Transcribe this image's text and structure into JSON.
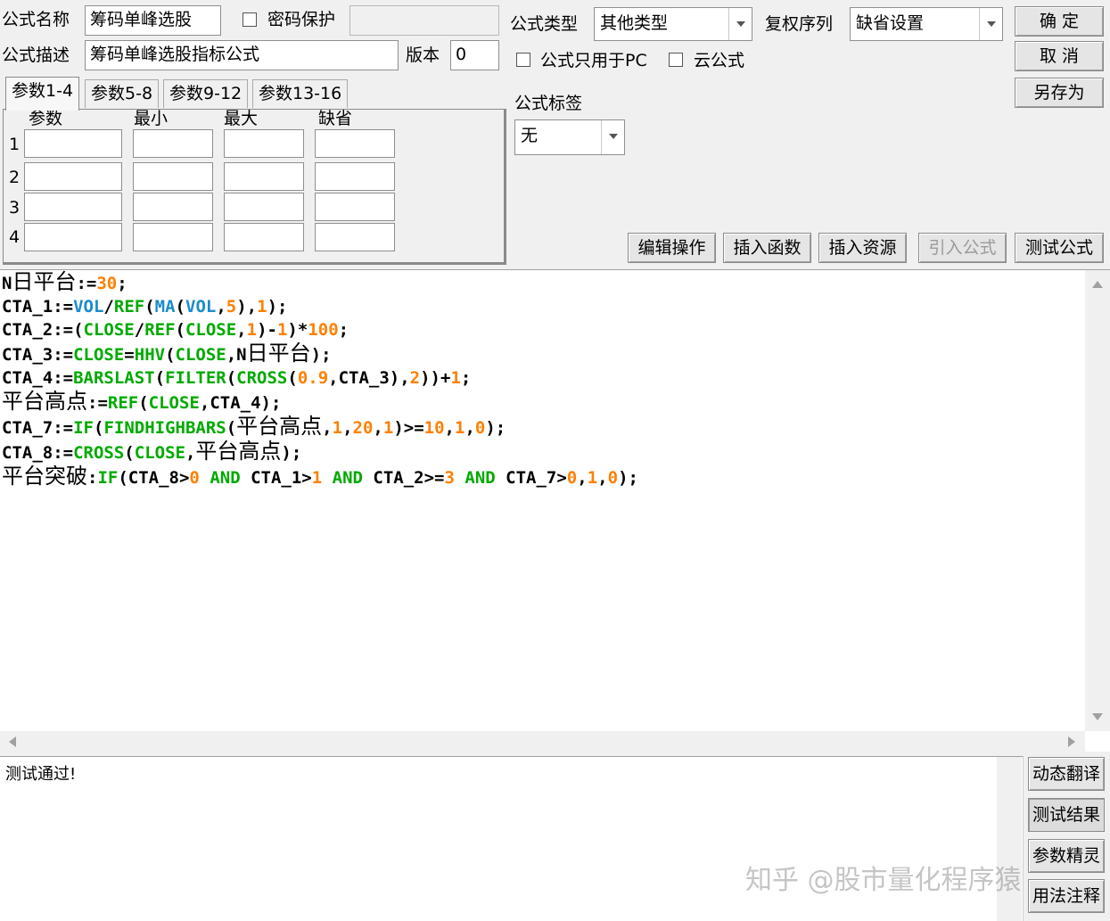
{
  "form": {
    "name_label": "公式名称",
    "name_value": "筹码单峰选股",
    "password_label": "密码保护",
    "desc_label": "公式描述",
    "desc_value": "筹码单峰选股指标公式",
    "version_label": "版本",
    "version_value": "0",
    "type_label": "公式类型",
    "type_value": "其他类型",
    "rights_label": "复权序列",
    "rights_value": "缺省设置",
    "pc_only_label": "公式只用于PC",
    "cloud_label": "云公式",
    "tag_label": "公式标签",
    "tag_value": "无"
  },
  "buttons": {
    "ok": "确  定",
    "cancel": "取  消",
    "save_as": "另存为",
    "edit_ops": "编辑操作",
    "insert_func": "插入函数",
    "insert_res": "插入资源",
    "import_formula": "引入公式",
    "test_formula": "测试公式",
    "dyn_translate": "动态翻译",
    "test_result": "测试结果",
    "param_wizard": "参数精灵",
    "usage_notes": "用法注释"
  },
  "params": {
    "tabs": [
      "参数1-4",
      "参数5-8",
      "参数9-12",
      "参数13-16"
    ],
    "headers": [
      "参数",
      "最小",
      "最大",
      "缺省"
    ],
    "rows": [
      "1",
      "2",
      "3",
      "4"
    ]
  },
  "editor": {
    "lines": [
      [
        [
          "N日平台",
          "v"
        ],
        [
          ":=",
          "o"
        ],
        [
          "30",
          "n"
        ],
        [
          ";",
          "o"
        ]
      ],
      [
        [
          "CTA_1",
          "v"
        ],
        [
          ":=",
          "o"
        ],
        [
          "VOL",
          "b"
        ],
        [
          "/",
          "o"
        ],
        [
          "REF",
          "f"
        ],
        [
          "(",
          "o"
        ],
        [
          "MA",
          "b"
        ],
        [
          "(",
          "o"
        ],
        [
          "VOL",
          "b"
        ],
        [
          ",",
          "o"
        ],
        [
          "5",
          "n"
        ],
        [
          "),",
          "o"
        ],
        [
          "1",
          "n"
        ],
        [
          ");",
          "o"
        ]
      ],
      [
        [
          "CTA_2",
          "v"
        ],
        [
          ":=(",
          "o"
        ],
        [
          "CLOSE",
          "f"
        ],
        [
          "/",
          "o"
        ],
        [
          "REF",
          "f"
        ],
        [
          "(",
          "o"
        ],
        [
          "CLOSE",
          "f"
        ],
        [
          ",",
          "o"
        ],
        [
          "1",
          "n"
        ],
        [
          ")-",
          "o"
        ],
        [
          "1",
          "n"
        ],
        [
          ")*",
          "o"
        ],
        [
          "100",
          "n"
        ],
        [
          ";",
          "o"
        ]
      ],
      [
        [
          "CTA_3",
          "v"
        ],
        [
          ":=",
          "o"
        ],
        [
          "CLOSE",
          "f"
        ],
        [
          "=",
          "o"
        ],
        [
          "HHV",
          "f"
        ],
        [
          "(",
          "o"
        ],
        [
          "CLOSE",
          "f"
        ],
        [
          ",N日平台);",
          "o"
        ]
      ],
      [
        [
          "CTA_4",
          "v"
        ],
        [
          ":=",
          "o"
        ],
        [
          "BARSLAST",
          "f"
        ],
        [
          "(",
          "o"
        ],
        [
          "FILTER",
          "f"
        ],
        [
          "(",
          "o"
        ],
        [
          "CROSS",
          "f"
        ],
        [
          "(",
          "o"
        ],
        [
          "0.9",
          "n"
        ],
        [
          ",CTA_3),",
          "o"
        ],
        [
          "2",
          "n"
        ],
        [
          "))+",
          "o"
        ],
        [
          "1",
          "n"
        ],
        [
          ";",
          "o"
        ]
      ],
      [
        [
          "平台高点",
          "v"
        ],
        [
          ":=",
          "o"
        ],
        [
          "REF",
          "f"
        ],
        [
          "(",
          "o"
        ],
        [
          "CLOSE",
          "f"
        ],
        [
          ",CTA_4);",
          "o"
        ]
      ],
      [
        [
          "CTA_7",
          "v"
        ],
        [
          ":=",
          "o"
        ],
        [
          "IF",
          "f"
        ],
        [
          "(",
          "o"
        ],
        [
          "FINDHIGHBARS",
          "f"
        ],
        [
          "(平台高点,",
          "o"
        ],
        [
          "1",
          "n"
        ],
        [
          ",",
          "o"
        ],
        [
          "20",
          "n"
        ],
        [
          ",",
          "o"
        ],
        [
          "1",
          "n"
        ],
        [
          ")>=",
          "o"
        ],
        [
          "10",
          "n"
        ],
        [
          ",",
          "o"
        ],
        [
          "1",
          "n"
        ],
        [
          ",",
          "o"
        ],
        [
          "0",
          "n"
        ],
        [
          ");",
          "o"
        ]
      ],
      [
        [
          "CTA_8",
          "v"
        ],
        [
          ":=",
          "o"
        ],
        [
          "CROSS",
          "f"
        ],
        [
          "(",
          "o"
        ],
        [
          "CLOSE",
          "f"
        ],
        [
          ",平台高点);",
          "o"
        ]
      ],
      [
        [
          "平台突破",
          "v"
        ],
        [
          ":",
          "o"
        ],
        [
          "IF",
          "f"
        ],
        [
          "(CTA_8>",
          "o"
        ],
        [
          "0",
          "n"
        ],
        [
          " ",
          "o"
        ],
        [
          "AND",
          "f"
        ],
        [
          " CTA_1>",
          "o"
        ],
        [
          "1",
          "n"
        ],
        [
          " ",
          "o"
        ],
        [
          "AND",
          "f"
        ],
        [
          " CTA_2>=",
          "o"
        ],
        [
          "3",
          "n"
        ],
        [
          " ",
          "o"
        ],
        [
          "AND",
          "f"
        ],
        [
          " CTA_7>",
          "o"
        ],
        [
          "0",
          "n"
        ],
        [
          ",",
          "o"
        ],
        [
          "1",
          "n"
        ],
        [
          ",",
          "o"
        ],
        [
          "0",
          "n"
        ],
        [
          ");",
          "o"
        ]
      ]
    ]
  },
  "output": {
    "text": "测试通过!"
  },
  "watermark": "知乎 @股市量化程序猿"
}
